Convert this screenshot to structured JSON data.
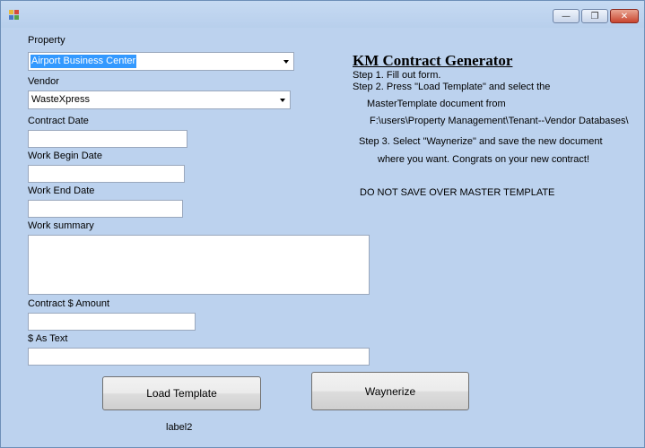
{
  "window": {
    "close_glyph": "✕",
    "maximize_glyph": "❐",
    "minimize_glyph": "—"
  },
  "form": {
    "property_label": "Property",
    "property_value": "Airport Business Center",
    "vendor_label": "Vendor",
    "vendor_value": "WasteXpress",
    "contract_date_label": "Contract Date",
    "work_begin_date_label": "Work Begin Date",
    "work_end_date_label": "Work End Date",
    "work_summary_label": "Work summary",
    "contract_amount_label": "Contract $ Amount",
    "as_text_label": "$ As Text",
    "load_template_button": "Load Template",
    "waynerize_button": "Waynerize",
    "status_label": "label2"
  },
  "instructions": {
    "title": "KM Contract Generator",
    "step1": "Step 1.  Fill out form.",
    "step2_line1": "Step 2.  Press \"Load Template\" and select the",
    "step2_line2": "MasterTemplate document from",
    "step2_line3": "F:\\users\\Property Management\\Tenant--Vendor Databases\\",
    "step3_line1": "Step 3.  Select \"Waynerize\" and save the new document",
    "step3_line2": "where you want.  Congrats on your new contract!",
    "warning": "DO NOT SAVE OVER MASTER TEMPLATE"
  }
}
